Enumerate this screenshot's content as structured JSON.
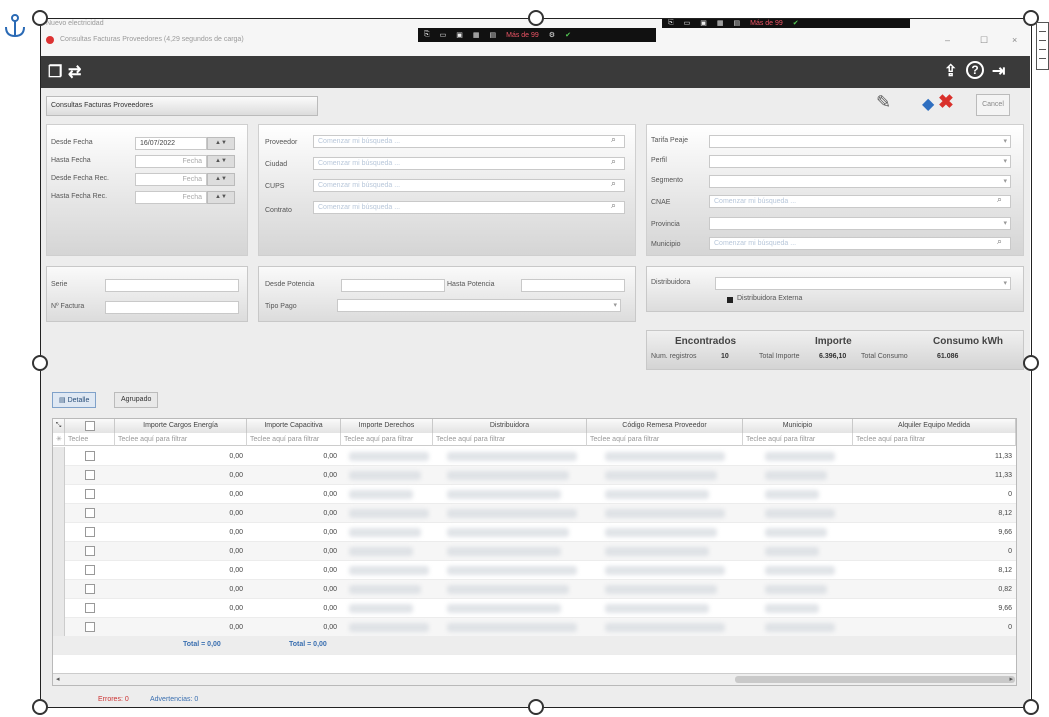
{
  "window": {
    "app_name": "Nuevo electricidad",
    "title": "Consultas Facturas Proveedores (4,29 segundos de carga)",
    "taskbar_top_center": {
      "more_label": "Más de 99"
    },
    "taskbar_top_right": {
      "more_label": "Más de 99"
    },
    "controls": {
      "minimize": "–",
      "maximize": "☐",
      "close": "×"
    }
  },
  "toolbar": {
    "left_icons": [
      "invoice-icon",
      "exchange-icon"
    ],
    "right_icons": [
      "upload-icon",
      "help-icon",
      "exit-icon"
    ]
  },
  "header": {
    "title": "Consultas Facturas Proveedores",
    "cancel_label": "Cancel"
  },
  "dates": {
    "desde_fecha_label": "Desde Fecha",
    "desde_fecha_value": "16/07/2022",
    "hasta_fecha_label": "Hasta Fecha",
    "hasta_fecha_value": "Fecha",
    "desde_fecha_rec_label": "Desde Fecha Rec.",
    "desde_fecha_rec_value": "Fecha",
    "hasta_fecha_rec_label": "Hasta Fecha Rec.",
    "hasta_fecha_rec_value": "Fecha"
  },
  "search_fields": {
    "proveedor_label": "Proveedor",
    "ciudad_label": "Ciudad",
    "cups_label": "CUPS",
    "contrato_label": "Contrato",
    "placeholder": "Comenzar mi búsqueda ..."
  },
  "right_filters": {
    "tarifa_label": "Tarifa Peaje",
    "perfil_label": "Perfil",
    "segmento_label": "Segmento",
    "cnae_label": "CNAE",
    "provincia_label": "Provincia",
    "municipio_label": "Municipio",
    "placeholder": "Comenzar mi búsqueda ..."
  },
  "serie": {
    "serie_label": "Serie",
    "factura_label": "Nº Factura"
  },
  "potencia": {
    "desde_label": "Desde Potencia",
    "hasta_label": "Hasta Potencia",
    "tipo_pago_label": "Tipo Pago"
  },
  "distribuidora": {
    "label": "Distribuidora",
    "externa_label": "Distribuidora Externa"
  },
  "summary": {
    "encontrados_title": "Encontrados",
    "importe_title": "Importe",
    "consumo_title": "Consumo kWh",
    "num_registros_label": "Num. registros",
    "num_registros_value": "10",
    "total_importe_label": "Total Importe",
    "total_importe_value": "6.396,10",
    "total_consumo_label": "Total Consumo",
    "total_consumo_value": "61.086"
  },
  "tabs": [
    {
      "label": "Detalle"
    },
    {
      "label": "Agrupado"
    }
  ],
  "grid": {
    "columns": [
      "Importe Cargos Energía",
      "Importe Capacitiva",
      "Importe Derechos",
      "Distribuidora",
      "Código Remesa Proveedor",
      "Municipio",
      "Alquiler Equipo Medida"
    ],
    "filter_placeholder": "Teclee aquí para filtrar",
    "first_filter": "Teclee",
    "rows": [
      {
        "cargos": "0,00",
        "capacitiva": "0,00",
        "alquiler": "11,33"
      },
      {
        "cargos": "0,00",
        "capacitiva": "0,00",
        "alquiler": "11,33"
      },
      {
        "cargos": "0,00",
        "capacitiva": "0,00",
        "alquiler": "0"
      },
      {
        "cargos": "0,00",
        "capacitiva": "0,00",
        "alquiler": "8,12"
      },
      {
        "cargos": "0,00",
        "capacitiva": "0,00",
        "alquiler": "9,66"
      },
      {
        "cargos": "0,00",
        "capacitiva": "0,00",
        "alquiler": "0"
      },
      {
        "cargos": "0,00",
        "capacitiva": "0,00",
        "alquiler": "8,12"
      },
      {
        "cargos": "0,00",
        "capacitiva": "0,00",
        "alquiler": "0,82"
      },
      {
        "cargos": "0,00",
        "capacitiva": "0,00",
        "alquiler": "9,66"
      },
      {
        "cargos": "0,00",
        "capacitiva": "0,00",
        "alquiler": "0"
      }
    ],
    "total_cargos": "Total = 0,00",
    "total_capacitiva": "Total = 0,00"
  },
  "status": {
    "errors_label": "Errores: 0",
    "warnings_label": "Advertencias: 0"
  },
  "colors": {
    "toolbar_bg": "#3a3a3a",
    "totals_blue": "#3a6fb0",
    "active_tab": "#dfe8f3",
    "delete_red": "#d9302b",
    "save_blue": "#2f6fc0"
  }
}
